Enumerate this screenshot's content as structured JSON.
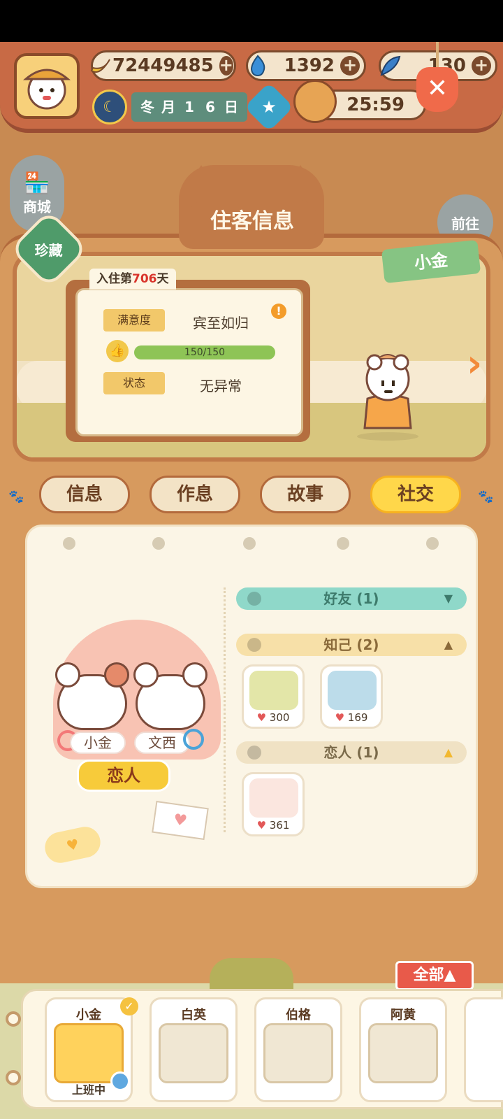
{
  "top": {
    "bananas": "72449485",
    "fire": "1392",
    "feather": "130",
    "date_chars": [
      "冬",
      "月",
      "1",
      "6",
      "日"
    ],
    "timer": "25:59"
  },
  "side": {
    "shop_label": "商城",
    "treasure_label": "珍藏",
    "go_label": "前往"
  },
  "header": {
    "title": "住客信息"
  },
  "guest": {
    "name": "小金"
  },
  "info": {
    "days_prefix": "入住第",
    "days_value": "706",
    "days_suffix": "天",
    "satisfaction_label": "满意度",
    "satisfaction_value": "宾至如归",
    "progress_text": "150/150",
    "progress_fraction": 1.0,
    "status_label": "状态",
    "status_value": "无异常"
  },
  "tabs": [
    {
      "label": "信息"
    },
    {
      "label": "作息"
    },
    {
      "label": "故事"
    },
    {
      "label": "社交"
    }
  ],
  "social": {
    "partner_left": "小金",
    "partner_right": "文西",
    "relation": "恋人",
    "categories": {
      "friend": "好友 (1)",
      "confidant": "知己 (2)",
      "lover": "恋人 (1)"
    },
    "confidants": [
      {
        "hearts": "300"
      },
      {
        "hearts": "169"
      }
    ],
    "lovers": [
      {
        "hearts": "361"
      }
    ]
  },
  "roster": {
    "all_label": "全部",
    "cards": [
      {
        "name": "小金",
        "status": "上班中"
      },
      {
        "name": "白英",
        "status": ""
      },
      {
        "name": "伯格",
        "status": ""
      },
      {
        "name": "阿黄",
        "status": ""
      }
    ]
  },
  "colors": {
    "accent": "#ffd74a",
    "panel": "#d79a5e",
    "progress": "#8ec456",
    "heart": "#e25858"
  }
}
